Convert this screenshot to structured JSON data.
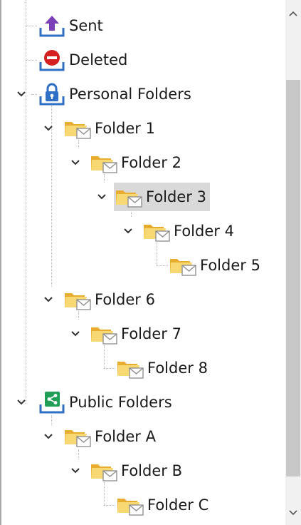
{
  "tree": {
    "nodes": [
      {
        "id": "sent",
        "label": "Sent",
        "icon": "sent-icon"
      },
      {
        "id": "deleted",
        "label": "Deleted",
        "icon": "deleted-icon"
      },
      {
        "id": "personal",
        "label": "Personal Folders",
        "icon": "lock-icon",
        "expanded": true
      },
      {
        "id": "folder1",
        "label": "Folder 1",
        "icon": "mail-folder-icon",
        "expanded": true
      },
      {
        "id": "folder2",
        "label": "Folder 2",
        "icon": "mail-folder-icon",
        "expanded": true
      },
      {
        "id": "folder3",
        "label": "Folder 3",
        "icon": "mail-folder-icon",
        "expanded": true,
        "selected": true
      },
      {
        "id": "folder4",
        "label": "Folder 4",
        "icon": "mail-folder-icon",
        "expanded": true
      },
      {
        "id": "folder5",
        "label": "Folder 5",
        "icon": "mail-folder-icon"
      },
      {
        "id": "folder6",
        "label": "Folder 6",
        "icon": "mail-folder-icon",
        "expanded": true
      },
      {
        "id": "folder7",
        "label": "Folder 7",
        "icon": "mail-folder-icon",
        "expanded": true
      },
      {
        "id": "folder8",
        "label": "Folder 8",
        "icon": "mail-folder-icon"
      },
      {
        "id": "public",
        "label": "Public Folders",
        "icon": "share-icon",
        "expanded": true
      },
      {
        "id": "folderA",
        "label": "Folder A",
        "icon": "mail-folder-icon",
        "expanded": true
      },
      {
        "id": "folderB",
        "label": "Folder B",
        "icon": "mail-folder-icon",
        "expanded": true
      },
      {
        "id": "folderC",
        "label": "Folder C",
        "icon": "mail-folder-icon"
      }
    ]
  },
  "colors": {
    "selection": "#d9d9d9",
    "sent_arrow": "#7b3fb8",
    "deleted_red": "#d42020",
    "accent_blue": "#2f6fc5",
    "share_green": "#1e9e57",
    "folder_yellow": "#f2c94f"
  },
  "scrollbar": {
    "up_icon": "chevron-up-icon",
    "down_icon": "chevron-down-icon"
  }
}
